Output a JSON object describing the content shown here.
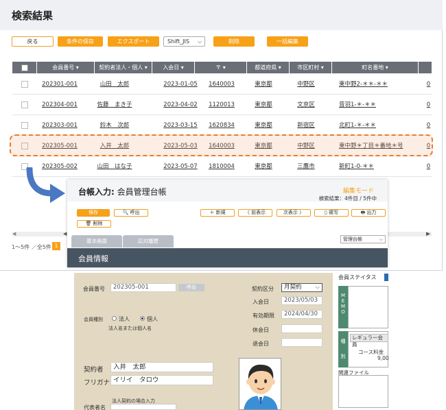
{
  "list": {
    "title": "検索結果",
    "toolbar": {
      "back": "戻る",
      "save_condition": "条件の保存",
      "export": "エクスポート",
      "encoding": "Shift_JIS",
      "delete": "削除",
      "bulk_edit": "一括編集"
    },
    "columns": [
      "会員番号",
      "契約者法人・個人",
      "入会日",
      "〒",
      "都道府県",
      "市区町村",
      "町名番地"
    ],
    "rows": [
      {
        "id": "202301-001",
        "name": "山田　太郎",
        "date": "2023-01-05",
        "zip": "1640003",
        "pref": "東京都",
        "city": "中野区",
        "addr": "東中野2-＊＊-＊＊",
        "extra": "0"
      },
      {
        "id": "202304-001",
        "name": "佐藤　まき子",
        "date": "2023-04-02",
        "zip": "1120013",
        "pref": "東京都",
        "city": "文京区",
        "addr": "音羽1-＊-＊＊",
        "extra": "0"
      },
      {
        "id": "202303-001",
        "name": "鈴木　次郎",
        "date": "2023-03-15",
        "zip": "1620834",
        "pref": "東京都",
        "city": "新宿区",
        "addr": "北町1-＊-＊＊",
        "extra": "0"
      },
      {
        "id": "202305-001",
        "name": "入井　太郎",
        "date": "2023-05-03",
        "zip": "1640003",
        "pref": "東京都",
        "city": "中野区",
        "addr": "東中野＊丁目＊番地＊号",
        "extra": "0"
      },
      {
        "id": "202305-002",
        "name": "山田　はな子",
        "date": "2023-05-07",
        "zip": "1810004",
        "pref": "東京都",
        "city": "三鷹市",
        "addr": "新町1-0-＊＊",
        "extra": "0"
      }
    ],
    "pager": {
      "text": "1〜5件 ／全5件",
      "page": "1"
    }
  },
  "ledger": {
    "title_bold": "台帳入力:",
    "title": "会員管理台帳",
    "mode": "編集モード",
    "result": "検索結果：4件目 / 5件中",
    "buttons": {
      "save": "保存",
      "call": "🔍 呼出",
      "new": "＋ 新規",
      "prev": "〈 前表示",
      "next": "次表示 〉",
      "copy": "▯ 複写",
      "print": "🖶 出力",
      "delete": "🗑 削除"
    },
    "tabs": [
      "基本画面",
      "応対履歴"
    ],
    "view_select": "管理台帳",
    "section": "会員情報"
  },
  "form": {
    "member_no_label": "会員番号",
    "member_no": "202305-001",
    "call_btn": "呼出",
    "member_type_label": "会員種別",
    "corp": "法人",
    "person": "個人",
    "type_hint": "法人名または個人名",
    "contract_type_label": "契約区分",
    "contract_type": "月契約",
    "join_label": "入会日",
    "join_date": "2023/05/03",
    "expire_label": "有効期限",
    "expire_date": "2024/04/30",
    "suspend_label": "休会日",
    "leave_label": "退会日",
    "contractor_label": "契約者",
    "contractor": "入井　太郎",
    "furigana_label": "フリガナ",
    "furigana": "イリイ　タロウ",
    "corp_hint": "法人契約の場合入力",
    "rep_label": "代表者名"
  },
  "status": {
    "title": "会員ステイタス",
    "memo": [
      "M",
      "E",
      "M",
      "O"
    ],
    "kind": [
      "種",
      "別"
    ],
    "regular": "レギュラー会員",
    "course_label": "コース料金",
    "course_value": "9,00",
    "files_label": "関連ファイル"
  },
  "colors": {
    "accent": "#f7a118",
    "header": "#6a6e76",
    "bar": "#475462",
    "form_bg": "#e3d9c2",
    "side": "#4e8a6e"
  }
}
